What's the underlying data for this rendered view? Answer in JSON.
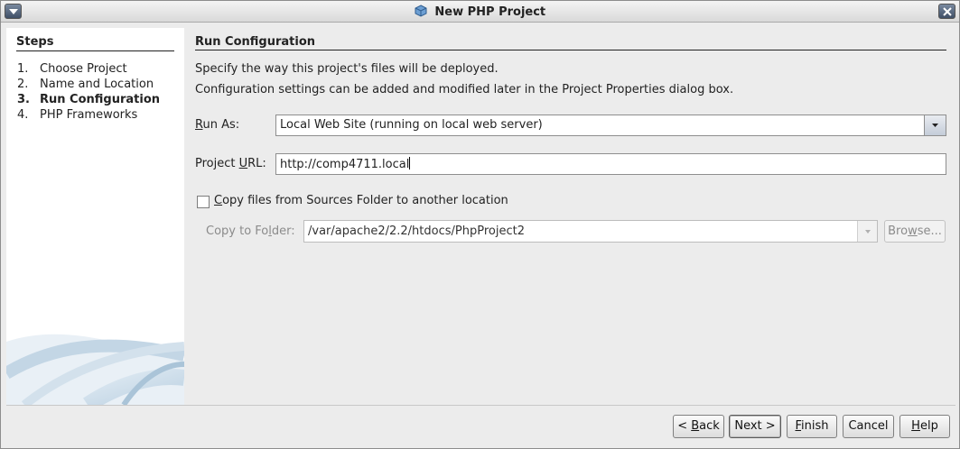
{
  "window": {
    "title": "New PHP Project"
  },
  "steps": {
    "heading": "Steps",
    "items": [
      {
        "num": "1.",
        "label": "Choose Project"
      },
      {
        "num": "2.",
        "label": "Name and Location"
      },
      {
        "num": "3.",
        "label": "Run Configuration"
      },
      {
        "num": "4.",
        "label": "PHP Frameworks"
      }
    ],
    "active_index": 2
  },
  "panel": {
    "title": "Run Configuration",
    "desc1": "Specify the way this project's files will be deployed.",
    "desc2": "Configuration settings can be added and modified later in the Project Properties dialog box.",
    "run_as": {
      "label_mn": "R",
      "label_rest": "un As:",
      "value": "Local Web Site (running on local web server)"
    },
    "project_url": {
      "label_pre": "Project ",
      "label_mn": "U",
      "label_rest": "RL:",
      "value": "http://comp4711.local"
    },
    "copy_files": {
      "label_mn": "C",
      "label_rest": "opy files from Sources Folder to another location",
      "checked": false
    },
    "copy_to": {
      "label_pre": "Copy to Fo",
      "label_mn": "l",
      "label_rest": "der:",
      "value": "/var/apache2/2.2/htdocs/PhpProject2",
      "browse_pre": "Bro",
      "browse_mn": "w",
      "browse_rest": "se..."
    }
  },
  "buttons": {
    "back": {
      "pre": "< ",
      "mn": "B",
      "rest": "ack"
    },
    "next": {
      "label": "Next >"
    },
    "finish": {
      "mn": "F",
      "rest": "inish"
    },
    "cancel": {
      "label": "Cancel"
    },
    "help": {
      "mn": "H",
      "rest": "elp"
    }
  },
  "icons": {
    "window_menu": "window-menu-icon",
    "window_close": "close-icon",
    "title": "netbeans-cube-icon",
    "combo_arrow": "chevron-down-icon"
  },
  "colors": {
    "accent": "#4a5f7e",
    "panel_bg": "#ececec",
    "steps_bg": "#ffffff"
  }
}
